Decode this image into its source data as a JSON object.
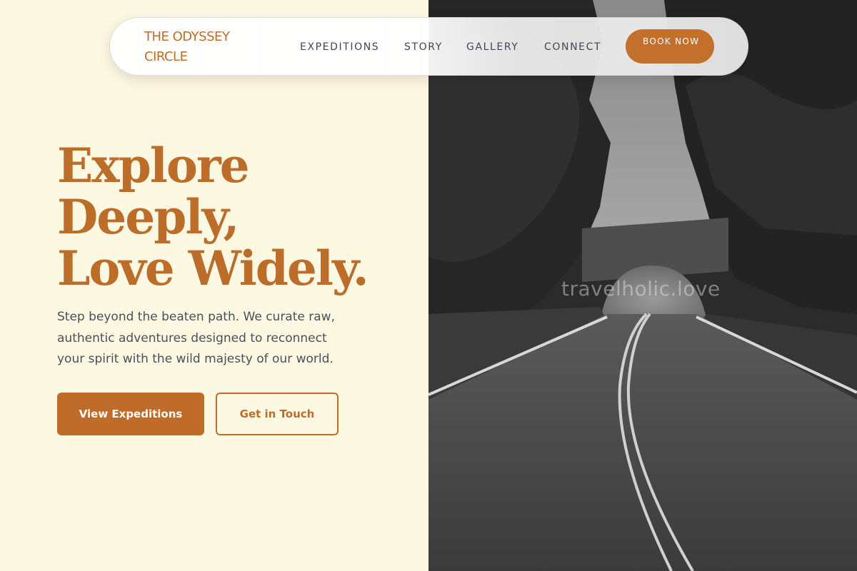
{
  "brand": {
    "name": "THE ODYSSEY CIRCLE"
  },
  "nav": {
    "links": [
      "EXPEDITIONS",
      "STORY",
      "GALLERY",
      "CONNECT"
    ],
    "cta": "BOOK NOW"
  },
  "hero": {
    "headline": [
      "Explore",
      "Deeply,",
      "Love Widely."
    ],
    "lead": "Step beyond the beaten path. We curate raw, authentic adventures designed to reconnect your spirit with the wild majesty of our world.",
    "primary_button": "View Expeditions",
    "secondary_button": "Get in Touch"
  },
  "photo": {
    "subject": "road-under-stone-bridge-photo",
    "watermark": "travelholic.love"
  },
  "colors": {
    "accent": "#bf6c2a",
    "background": "#fdf8e2",
    "text": "#4b4f5a"
  }
}
